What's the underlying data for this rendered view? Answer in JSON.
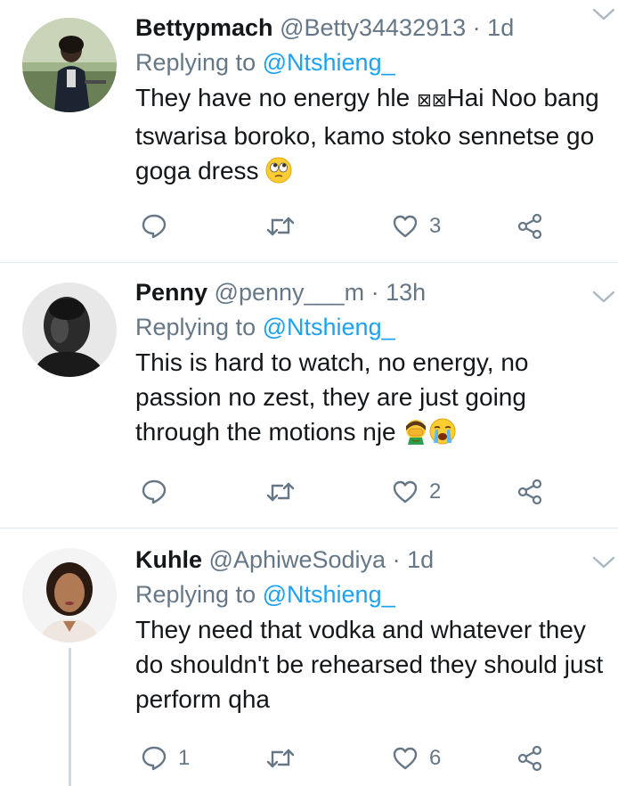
{
  "tweets": [
    {
      "display_name": "Bettypmach",
      "handle": "@Betty34432913",
      "separator": "·",
      "time": "1d",
      "replying_prefix": "Replying to",
      "replying_to": "@Ntshieng_",
      "text": "They have no energy hle 🤦‍♀️ Hai Noo bang tswarisa boroko, kamo stoko sennetse go goga dress",
      "text_main": "They have no energy hle ",
      "text_glyph": "⊠⊠",
      "text_rest": "Hai Noo bang tswarisa boroko, kamo stoko sennetse go goga dress",
      "emoji_end": "face-with-rolling-eyes-emoji",
      "reply_count": "",
      "retweet_count": "",
      "like_count": "3",
      "avatar": "avatar-bettypmach"
    },
    {
      "display_name": "Penny",
      "handle": "@penny___m",
      "separator": "·",
      "time": "13h",
      "replying_prefix": "Replying to",
      "replying_to": "@Ntshieng_",
      "text": "This is hard to watch, no energy, no passion no zest, they are just going through the motions nje",
      "emoji_end": "man-facepalming-emoji, loudly-crying-face-emoji",
      "reply_count": "",
      "retweet_count": "",
      "like_count": "2",
      "avatar": "avatar-penny"
    },
    {
      "display_name": "Kuhle",
      "handle": "@AphiweSodiya",
      "separator": "·",
      "time": "1d",
      "replying_prefix": "Replying to",
      "replying_to": "@Ntshieng_",
      "text": "They need that vodka and whatever they do shouldn't be rehearsed they should just perform qha",
      "reply_count": "1",
      "retweet_count": "",
      "like_count": "6",
      "avatar": "avatar-kuhle"
    }
  ],
  "icons": {
    "reply": "reply-bubble-icon",
    "retweet": "retweet-icon",
    "like": "heart-icon",
    "share": "share-icon",
    "more": "chevron-down-icon"
  },
  "colors": {
    "text": "#14171a",
    "secondary": "#657786",
    "link": "#1da1f2",
    "divider": "#e1e8ed",
    "thread_line": "#cfd9de"
  }
}
